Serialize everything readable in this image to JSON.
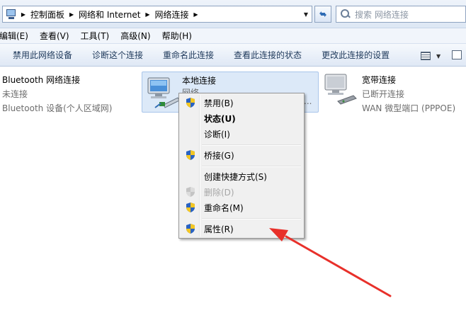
{
  "address_bar": {
    "breadcrumbs": [
      "控制面板",
      "网络和 Internet",
      "网络连接"
    ],
    "search_placeholder": "搜索 网络连接"
  },
  "menu": [
    "编辑(E)",
    "查看(V)",
    "工具(T)",
    "高级(N)",
    "帮助(H)"
  ],
  "commands": [
    "禁用此网络设备",
    "诊断这个连接",
    "重命名此连接",
    "查看此连接的状态",
    "更改此连接的设置"
  ],
  "connections": {
    "bluetooth": {
      "name": "Bluetooth 网络连接",
      "status": "未连接",
      "device": "Bluetooth 设备(个人区域网)"
    },
    "local": {
      "name": "本地连接",
      "status": "网络",
      "ellipsis": "..."
    },
    "broadband": {
      "name": "宽带连接",
      "status": "已断开连接",
      "device": "WAN 微型端口 (PPPOE)"
    }
  },
  "context_menu": {
    "disable": "禁用(B)",
    "status": "状态(U)",
    "diagnose": "诊断(I)",
    "bridge": "桥接(G)",
    "shortcut": "创建快捷方式(S)",
    "delete": "删除(D)",
    "rename": "重命名(M)",
    "properties": "属性(R)"
  },
  "colors": {
    "arrow": "#e8302a",
    "selection": "#dce9f8",
    "command_text": "#1e395b"
  }
}
